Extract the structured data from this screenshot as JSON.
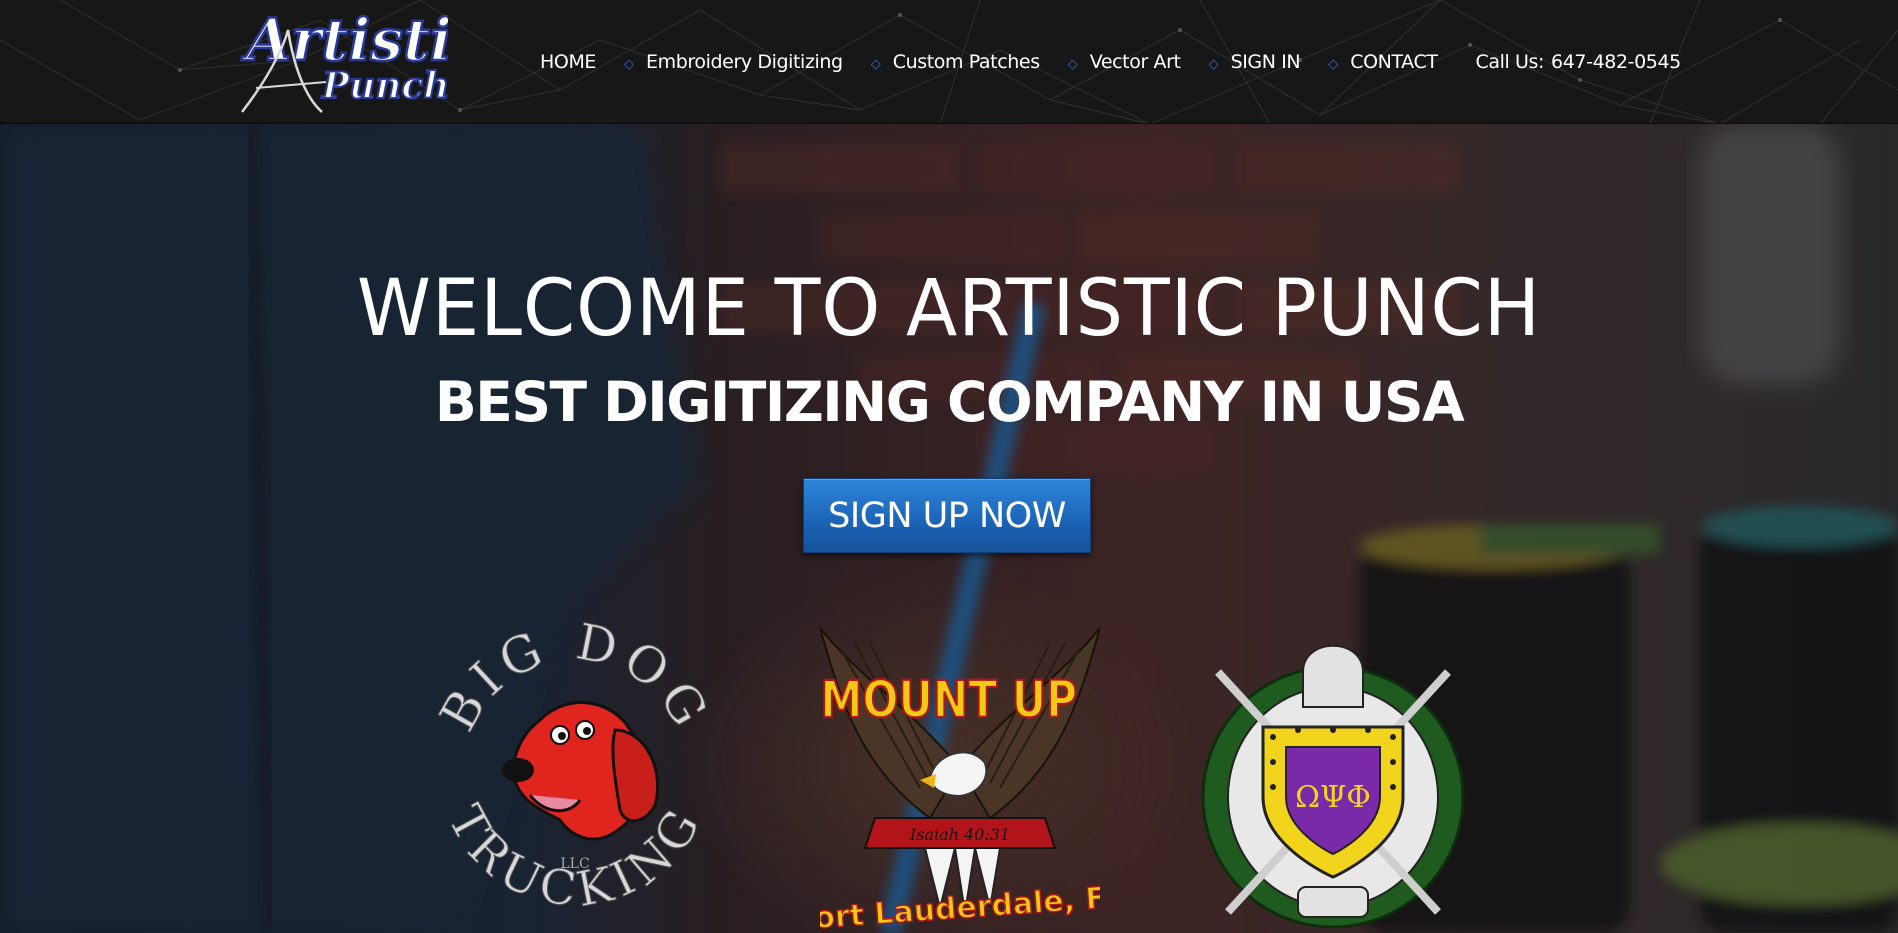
{
  "header": {
    "logo_text_top": "Artistic",
    "logo_text_bottom": "Punch",
    "nav": [
      {
        "label": "HOME"
      },
      {
        "label": "Embroidery Digitizing"
      },
      {
        "label": "Custom Patches"
      },
      {
        "label": "Vector Art"
      },
      {
        "label": "SIGN IN"
      },
      {
        "label": "CONTACT"
      }
    ],
    "separator_icon": "diamond-outline-icon",
    "call_label": "Call Us:",
    "call_number": "647-482-0545"
  },
  "hero": {
    "title": "WELCOME TO ARTISTIC PUNCH",
    "subtitle": "BEST DIGITIZING COMPANY IN USA",
    "cta_label": "SIGN UP NOW",
    "badges": {
      "bigdog": {
        "top": "BIG DOG",
        "bottom": "TRUCKING",
        "small": "LLC"
      },
      "mountup": {
        "top": "MOUNT UP",
        "banner": "Isaiah 40:31",
        "bottom": "Fort Lauderdale, FL"
      },
      "crest": {
        "letters": "ΩΨΦ"
      }
    }
  },
  "colors": {
    "header_bg": "#171717",
    "accent_blue": "#2f6fd6",
    "button_blue": "#1b63b6",
    "logo_blue": "#3b4fb8"
  }
}
